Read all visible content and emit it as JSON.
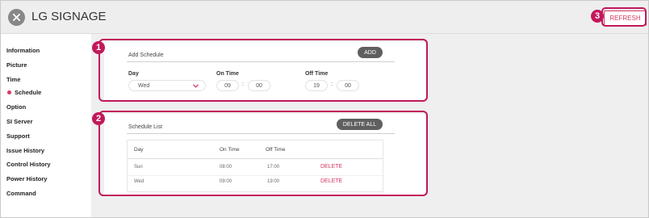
{
  "header": {
    "title": "LG SIGNAGE",
    "refresh_label": "REFRESH"
  },
  "sidebar": {
    "items": [
      {
        "label": "Information",
        "active": false
      },
      {
        "label": "Picture",
        "active": false
      },
      {
        "label": "Time",
        "active": false
      },
      {
        "label": "Schedule",
        "active": true
      },
      {
        "label": "Option",
        "active": false
      },
      {
        "label": "SI Server",
        "active": false
      },
      {
        "label": "Support",
        "active": false
      },
      {
        "label": "Issue History",
        "active": false
      },
      {
        "label": "Control History",
        "active": false
      },
      {
        "label": "Power History",
        "active": false
      },
      {
        "label": "Command",
        "active": false
      }
    ]
  },
  "add_schedule": {
    "title": "Add Schedule",
    "add_label": "ADD",
    "day_label": "Day",
    "day_value": "Wed",
    "on_time_label": "On Time",
    "on_hour": "09",
    "on_min": "00",
    "off_time_label": "Off Time",
    "off_hour": "19",
    "off_min": "00",
    "separator": ":"
  },
  "schedule_list": {
    "title": "Schedule List",
    "delete_all_label": "DELETE ALL",
    "columns": [
      "Day",
      "On Time",
      "Off Time"
    ],
    "rows": [
      {
        "day": "Sun",
        "on": "08:00",
        "off": "17:00",
        "action": "DELETE"
      },
      {
        "day": "Wed",
        "on": "09:00",
        "off": "19:00",
        "action": "DELETE"
      }
    ]
  },
  "callouts": [
    "1",
    "2",
    "3"
  ],
  "colors": {
    "accent": "#d63a62",
    "callout": "#c2185b",
    "header_bg": "#eeeeee",
    "content_bg": "#efefef",
    "pill": "#5f5f5f"
  }
}
